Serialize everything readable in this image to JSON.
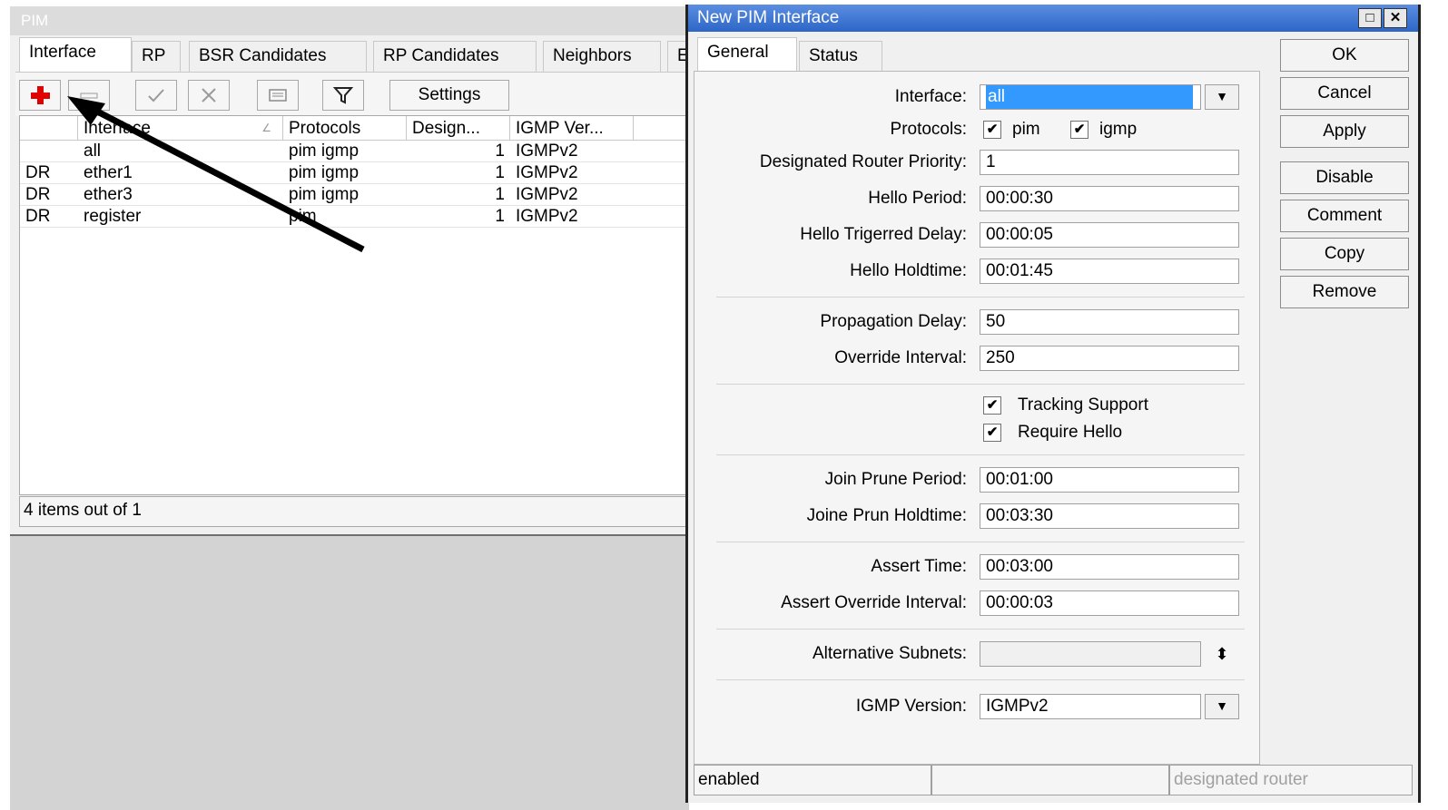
{
  "pim_window": {
    "title": "PIM",
    "tabs": [
      "Interface",
      "RP",
      "BSR Candidates",
      "RP Candidates",
      "Neighbors",
      "E"
    ],
    "toolbar": {
      "settings_label": "Settings"
    },
    "columns": [
      "Interface",
      "Protocols",
      "Design...",
      "IGMP Ver..."
    ],
    "rows": [
      {
        "flag": "",
        "interface": "all",
        "protocols": "pim igmp",
        "priority": "1",
        "igmp": "IGMPv2"
      },
      {
        "flag": "DR",
        "interface": "ether1",
        "protocols": "pim igmp",
        "priority": "1",
        "igmp": "IGMPv2"
      },
      {
        "flag": "DR",
        "interface": "ether3",
        "protocols": "pim igmp",
        "priority": "1",
        "igmp": "IGMPv2"
      },
      {
        "flag": "DR",
        "interface": "register",
        "protocols": "pim",
        "priority": "1",
        "igmp": "IGMPv2"
      }
    ],
    "status": "4 items out of 1"
  },
  "dialog": {
    "title": "New PIM Interface",
    "tabs": [
      "General",
      "Status"
    ],
    "fields": {
      "interface": {
        "label": "Interface:",
        "value": "all"
      },
      "protocols": {
        "label": "Protocols:",
        "pim": "pim",
        "igmp": "igmp"
      },
      "dr_priority": {
        "label": "Designated Router Priority:",
        "value": "1"
      },
      "hello_period": {
        "label": "Hello Period:",
        "value": "00:00:30"
      },
      "hello_trig_delay": {
        "label": "Hello Trigerred Delay:",
        "value": "00:00:05"
      },
      "hello_holdtime": {
        "label": "Hello Holdtime:",
        "value": "00:01:45"
      },
      "propagation_delay": {
        "label": "Propagation Delay:",
        "value": "50"
      },
      "override_interval": {
        "label": "Override Interval:",
        "value": "250"
      },
      "tracking_support": {
        "label": "Tracking Support"
      },
      "require_hello": {
        "label": "Require Hello"
      },
      "join_prune_period": {
        "label": "Join Prune Period:",
        "value": "00:01:00"
      },
      "join_prune_holdtime": {
        "label": "Joine Prun Holdtime:",
        "value": "00:03:30"
      },
      "assert_time": {
        "label": "Assert Time:",
        "value": "00:03:00"
      },
      "assert_override": {
        "label": "Assert Override Interval:",
        "value": "00:00:03"
      },
      "alt_subnets": {
        "label": "Alternative Subnets:",
        "value": ""
      },
      "igmp_version": {
        "label": "IGMP Version:",
        "value": "IGMPv2"
      }
    },
    "buttons": [
      "OK",
      "Cancel",
      "Apply",
      "Disable",
      "Comment",
      "Copy",
      "Remove"
    ],
    "status": [
      "enabled",
      "",
      "designated router"
    ]
  },
  "icons": {
    "add": "plus-icon",
    "remove": "minus-icon",
    "enable": "check-icon",
    "disable": "cross-icon",
    "comment": "comment-icon",
    "filter": "filter-icon",
    "dropdown": "dropdown-icon",
    "updown": "updown-icon"
  },
  "colors": {
    "add_icon": "#e00000",
    "title_bar": "#3c78d8",
    "selection": "#3399ff"
  }
}
